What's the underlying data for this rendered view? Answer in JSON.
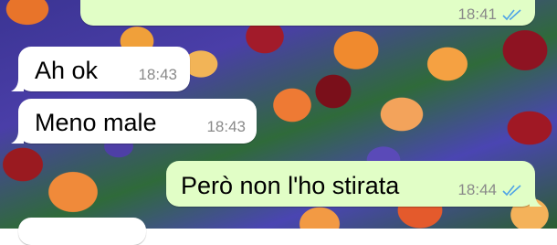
{
  "chat": {
    "messages": [
      {
        "direction": "outgoing",
        "text": "",
        "time": "18:41",
        "status_icon": "double-check-icon"
      },
      {
        "direction": "incoming",
        "text": "Ah ok",
        "time": "18:43"
      },
      {
        "direction": "incoming",
        "text": "Meno male",
        "time": "18:43"
      },
      {
        "direction": "outgoing",
        "text": "Però non l'ho stirata",
        "time": "18:44",
        "status_icon": "double-check-icon"
      },
      {
        "direction": "incoming",
        "text": ""
      }
    ]
  },
  "colors": {
    "incoming_bubble": "#ffffff",
    "outgoing_bubble": "#e1fec6",
    "read_ticks": "#4fa3e6",
    "timestamp": "#8a8a8a"
  },
  "wallpaper": "tulips-and-grape-hyacinths-photo"
}
